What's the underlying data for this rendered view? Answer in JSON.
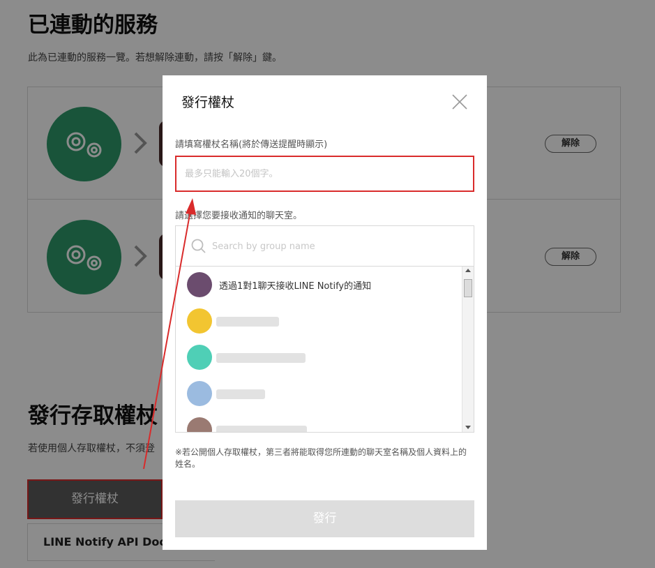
{
  "background": {
    "linked_title": "已連動的服務",
    "linked_desc": "此為已連動的服務一覽。若想解除連動，請按「解除」鍵。",
    "services": [
      {
        "unlink_label": "解除"
      },
      {
        "unlink_label": "解除"
      }
    ],
    "issue_title": "發行存取權杖",
    "issue_desc": "若使用個人存取權杖，不須登",
    "issue_button": "發行權杖",
    "api_doc_link": "LINE Notify API Doc"
  },
  "modal": {
    "title": "發行權杖",
    "name_label": "請填寫權杖名稱(將於傳送提醒時顯示)",
    "name_placeholder": "最多只能輸入20個字。",
    "name_value": "",
    "room_label": "請選擇您要接收通知的聊天室。",
    "search_placeholder": "Search by group name",
    "rooms": [
      {
        "name": "透過1對1聊天接收LINE Notify的通知",
        "avatar_color": "#6b4c6e"
      },
      {
        "name": "",
        "avatar_color": "#f2c531"
      },
      {
        "name": "",
        "avatar_color": "#4fcfb6"
      },
      {
        "name": "",
        "avatar_color": "#9bbbe0"
      },
      {
        "name": "",
        "avatar_color": "#9a7a72"
      }
    ],
    "note": "※若公開個人存取權杖，第三者將能取得您所連動的聊天室名稱及個人資料上的姓名。",
    "submit_label": "發行"
  },
  "colors": {
    "accent_green": "#2e9a6b",
    "highlight_red": "#d92b2b",
    "disabled_button": "#dddddd"
  },
  "icons": [
    "gear-icon",
    "chevron-right-icon",
    "close-icon",
    "search-icon",
    "annotation-arrow"
  ]
}
